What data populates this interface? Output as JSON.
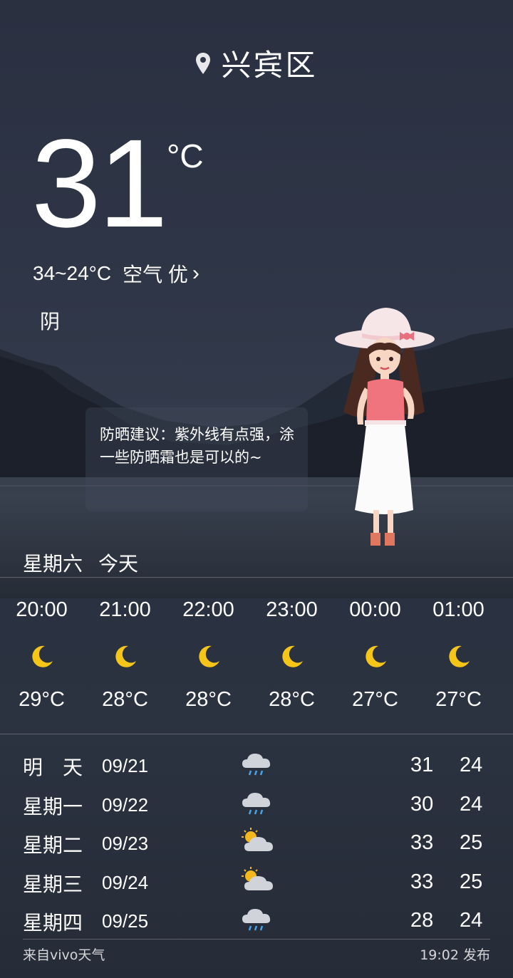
{
  "location": {
    "name": "兴宾区",
    "icon": "location-pin-icon"
  },
  "current": {
    "temperature": "31",
    "unit": "°C",
    "range": "34~24°C",
    "air_quality": "空气 优",
    "condition": "阴"
  },
  "tip": {
    "text": "防晒建议：紫外线有点强，涂一些防晒霜也是可以的~"
  },
  "today": {
    "weekday": "星期六",
    "label": "今天"
  },
  "hourly": [
    {
      "time": "20:00",
      "icon": "moon-icon",
      "temp": "29°C"
    },
    {
      "time": "21:00",
      "icon": "moon-icon",
      "temp": "28°C"
    },
    {
      "time": "22:00",
      "icon": "moon-icon",
      "temp": "28°C"
    },
    {
      "time": "23:00",
      "icon": "moon-icon",
      "temp": "28°C"
    },
    {
      "time": "00:00",
      "icon": "moon-icon",
      "temp": "27°C"
    },
    {
      "time": "01:00",
      "icon": "moon-icon",
      "temp": "27°C"
    }
  ],
  "daily": [
    {
      "day": "明　天",
      "date": "09/21",
      "icon": "rain-cloud-icon",
      "high": "31",
      "low": "24"
    },
    {
      "day": "星期一",
      "date": "09/22",
      "icon": "rain-cloud-icon",
      "high": "30",
      "low": "24"
    },
    {
      "day": "星期二",
      "date": "09/23",
      "icon": "partly-cloudy-icon",
      "high": "33",
      "low": "25"
    },
    {
      "day": "星期三",
      "date": "09/24",
      "icon": "partly-cloudy-icon",
      "high": "33",
      "low": "25"
    },
    {
      "day": "星期四",
      "date": "09/25",
      "icon": "rain-cloud-icon",
      "high": "28",
      "low": "24"
    }
  ],
  "footer": {
    "source": "来自vivo天气",
    "published": "19:02 发布"
  },
  "colors": {
    "moon": "#f5c518",
    "sun": "#f5b81c",
    "background": "#2f3647"
  }
}
